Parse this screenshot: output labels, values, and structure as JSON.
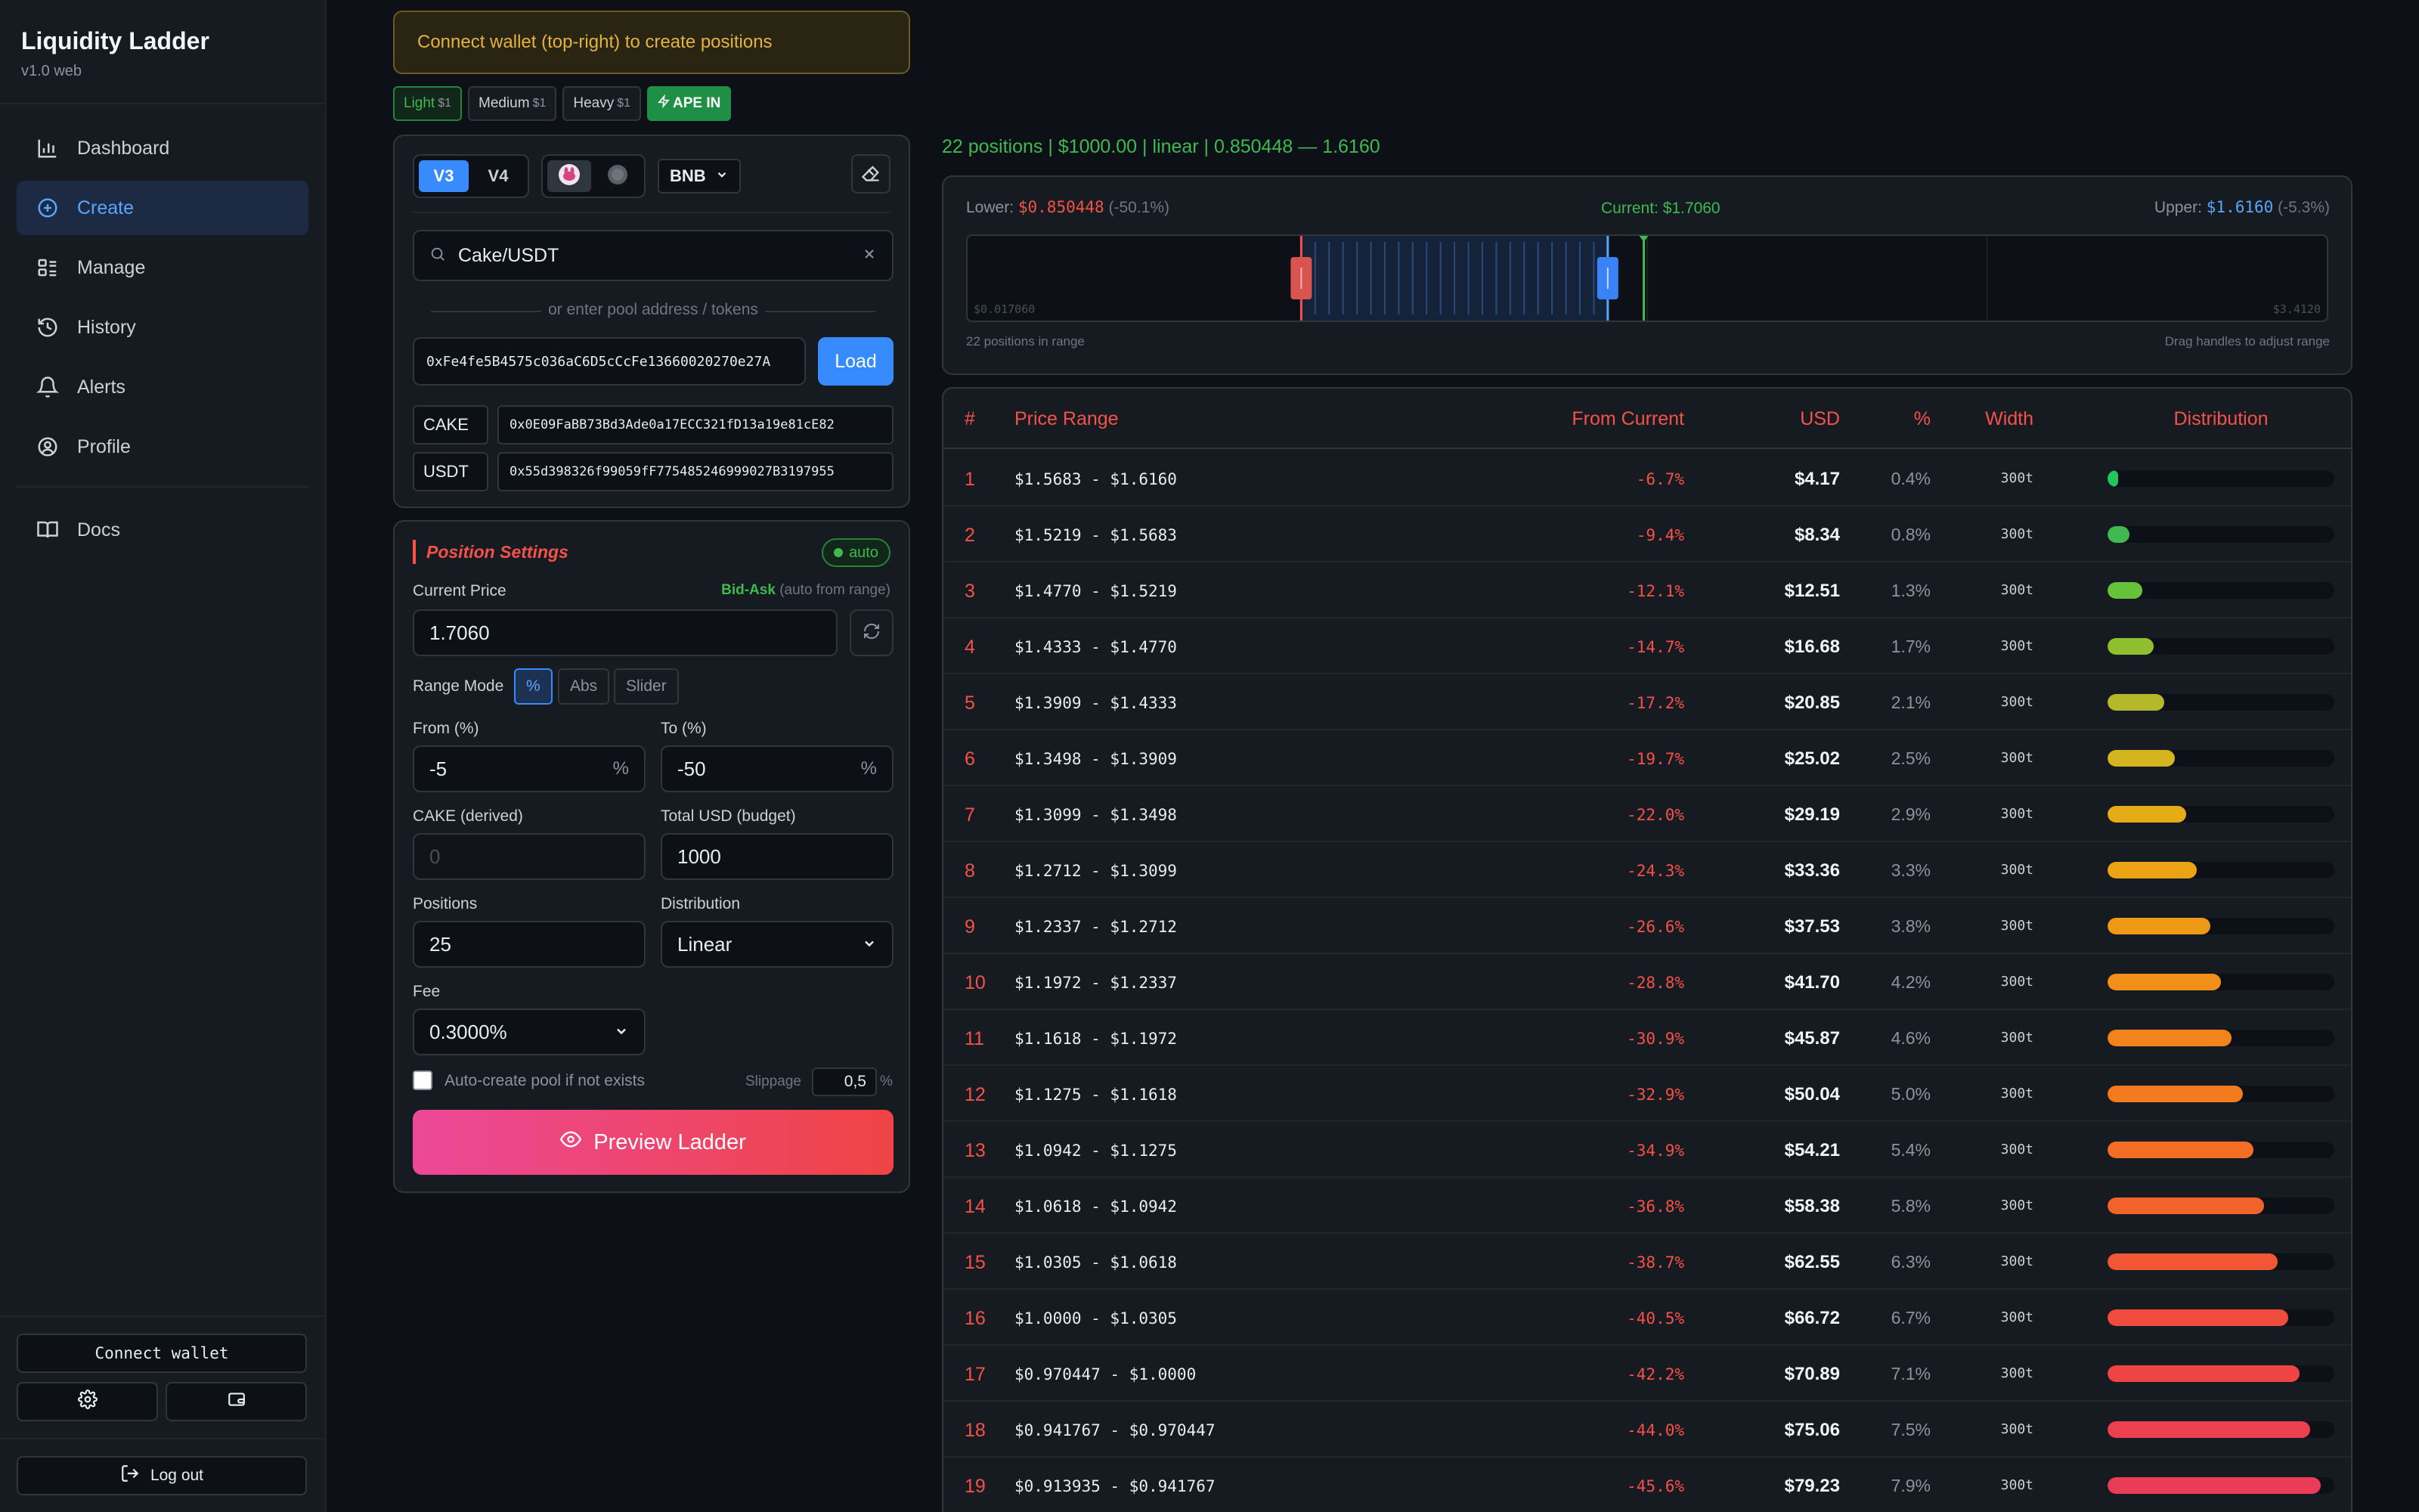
{
  "app": {
    "title": "Liquidity Ladder",
    "version": "v1.0 web"
  },
  "nav": [
    {
      "label": "Dashboard",
      "icon": "chart-bar-icon",
      "active": false
    },
    {
      "label": "Create",
      "icon": "plus-circle-icon",
      "active": true
    },
    {
      "label": "Manage",
      "icon": "grid-icon",
      "active": false
    },
    {
      "label": "History",
      "icon": "history-icon",
      "active": false
    },
    {
      "label": "Alerts",
      "icon": "bell-icon",
      "active": false
    },
    {
      "label": "Profile",
      "icon": "user-circle-icon",
      "active": false
    }
  ],
  "nav_docs": {
    "label": "Docs",
    "icon": "book-icon"
  },
  "sidebar_bottom": {
    "connect": "Connect wallet",
    "logout": "Log out",
    "settings_icon": "gear-icon",
    "wallet_icon": "wallet-icon"
  },
  "warning": "Connect wallet (top-right) to create positions",
  "presets": [
    {
      "label": "Light",
      "price": "$1"
    },
    {
      "label": "Medium",
      "price": "$1"
    },
    {
      "label": "Heavy",
      "price": "$1"
    },
    {
      "label": "APE IN",
      "price": ""
    }
  ],
  "pool": {
    "versions": [
      "V3",
      "V4"
    ],
    "chain": "BNB",
    "search_value": "Cake/USDT",
    "or_text": "or enter pool address / tokens",
    "address": "0xFe4fe5B4575c036aC6D5cCcFe13660020270e27A",
    "load": "Load",
    "token0": {
      "symbol": "CAKE",
      "address": "0x0E09FaBB73Bd3Ade0a17ECC321fD13a19e81cE82"
    },
    "token1": {
      "symbol": "USDT",
      "address": "0x55d398326f99059fF775485246999027B3197955"
    }
  },
  "settings": {
    "title": "Position Settings",
    "auto": "auto",
    "current_price_label": "Current Price",
    "bid_ask": "Bid-Ask",
    "bid_ask_note": "(auto from range)",
    "current_price": "1.7060",
    "range_mode_label": "Range Mode",
    "range_modes": [
      "%",
      "Abs",
      "Slider"
    ],
    "from_label": "From (%)",
    "from_value": "-5",
    "to_label": "To (%)",
    "to_value": "-50",
    "pct_suffix": "%",
    "derived_label": "CAKE (derived)",
    "derived_value": "0",
    "budget_label": "Total USD (budget)",
    "budget_value": "1000",
    "positions_label": "Positions",
    "positions_value": "25",
    "distribution_label": "Distribution",
    "distribution_value": "Linear",
    "fee_label": "Fee",
    "fee_value": "0.3000%",
    "auto_create_label": "Auto-create pool if not exists",
    "slippage_label": "Slippage",
    "slippage_value": "0,5",
    "slippage_suffix": "%",
    "preview": "Preview Ladder"
  },
  "summary": "22 positions | $1000.00 | linear | 0.850448 — 1.6160",
  "range": {
    "lower_label": "Lower:",
    "lower_value": "$0.850448",
    "lower_pct": "(-50.1%)",
    "current": "Current: $1.7060",
    "upper_label": "Upper:",
    "upper_value": "$1.6160",
    "upper_pct": "(-5.3%)",
    "min_tick": "$0.017060",
    "max_tick": "$3.4120",
    "footer_left": "22 positions in range",
    "footer_right": "Drag handles to adjust range",
    "min": 0.01706,
    "max": 3.412,
    "lower": 0.850448,
    "upper": 1.616,
    "price": 1.706
  },
  "table": {
    "headers": [
      "#",
      "Price Range",
      "From Current",
      "USD",
      "%",
      "Width",
      "Distribution"
    ],
    "rows": [
      {
        "n": "1",
        "range": "$1.5683 - $1.6160",
        "from": "-6.7%",
        "usd": "$4.17",
        "pct": "0.4%",
        "width": "300t",
        "share": 0.4
      },
      {
        "n": "2",
        "range": "$1.5219 - $1.5683",
        "from": "-9.4%",
        "usd": "$8.34",
        "pct": "0.8%",
        "width": "300t",
        "share": 0.8
      },
      {
        "n": "3",
        "range": "$1.4770 - $1.5219",
        "from": "-12.1%",
        "usd": "$12.51",
        "pct": "1.3%",
        "width": "300t",
        "share": 1.3
      },
      {
        "n": "4",
        "range": "$1.4333 - $1.4770",
        "from": "-14.7%",
        "usd": "$16.68",
        "pct": "1.7%",
        "width": "300t",
        "share": 1.7
      },
      {
        "n": "5",
        "range": "$1.3909 - $1.4333",
        "from": "-17.2%",
        "usd": "$20.85",
        "pct": "2.1%",
        "width": "300t",
        "share": 2.1
      },
      {
        "n": "6",
        "range": "$1.3498 - $1.3909",
        "from": "-19.7%",
        "usd": "$25.02",
        "pct": "2.5%",
        "width": "300t",
        "share": 2.5
      },
      {
        "n": "7",
        "range": "$1.3099 - $1.3498",
        "from": "-22.0%",
        "usd": "$29.19",
        "pct": "2.9%",
        "width": "300t",
        "share": 2.9
      },
      {
        "n": "8",
        "range": "$1.2712 - $1.3099",
        "from": "-24.3%",
        "usd": "$33.36",
        "pct": "3.3%",
        "width": "300t",
        "share": 3.3
      },
      {
        "n": "9",
        "range": "$1.2337 - $1.2712",
        "from": "-26.6%",
        "usd": "$37.53",
        "pct": "3.8%",
        "width": "300t",
        "share": 3.8
      },
      {
        "n": "10",
        "range": "$1.1972 - $1.2337",
        "from": "-28.8%",
        "usd": "$41.70",
        "pct": "4.2%",
        "width": "300t",
        "share": 4.2
      },
      {
        "n": "11",
        "range": "$1.1618 - $1.1972",
        "from": "-30.9%",
        "usd": "$45.87",
        "pct": "4.6%",
        "width": "300t",
        "share": 4.6
      },
      {
        "n": "12",
        "range": "$1.1275 - $1.1618",
        "from": "-32.9%",
        "usd": "$50.04",
        "pct": "5.0%",
        "width": "300t",
        "share": 5.0
      },
      {
        "n": "13",
        "range": "$1.0942 - $1.1275",
        "from": "-34.9%",
        "usd": "$54.21",
        "pct": "5.4%",
        "width": "300t",
        "share": 5.4
      },
      {
        "n": "14",
        "range": "$1.0618 - $1.0942",
        "from": "-36.8%",
        "usd": "$58.38",
        "pct": "5.8%",
        "width": "300t",
        "share": 5.8
      },
      {
        "n": "15",
        "range": "$1.0305 - $1.0618",
        "from": "-38.7%",
        "usd": "$62.55",
        "pct": "6.3%",
        "width": "300t",
        "share": 6.3
      },
      {
        "n": "16",
        "range": "$1.0000 - $1.0305",
        "from": "-40.5%",
        "usd": "$66.72",
        "pct": "6.7%",
        "width": "300t",
        "share": 6.7
      },
      {
        "n": "17",
        "range": "$0.970447 - $1.0000",
        "from": "-42.2%",
        "usd": "$70.89",
        "pct": "7.1%",
        "width": "300t",
        "share": 7.1
      },
      {
        "n": "18",
        "range": "$0.941767 - $0.970447",
        "from": "-44.0%",
        "usd": "$75.06",
        "pct": "7.5%",
        "width": "300t",
        "share": 7.5
      },
      {
        "n": "19",
        "range": "$0.913935 - $0.941767",
        "from": "-45.6%",
        "usd": "$79.23",
        "pct": "7.9%",
        "width": "300t",
        "share": 7.9
      }
    ]
  },
  "colors": {
    "accent_blue": "#388bfd",
    "accent_green": "#3fb950",
    "accent_red": "#f85149",
    "warning": "#e3b341"
  }
}
